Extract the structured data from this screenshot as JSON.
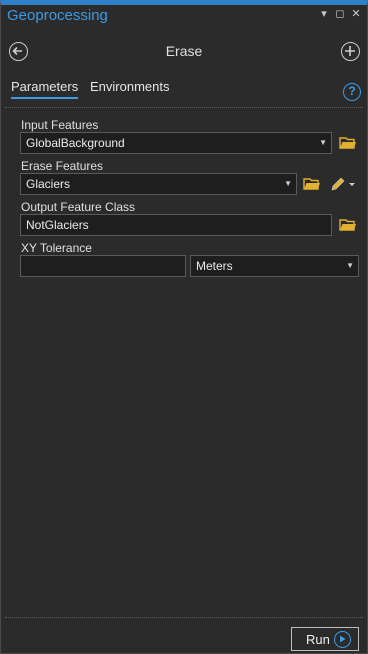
{
  "window": {
    "title": "Geoprocessing",
    "colors": {
      "accent": "#3a9be6",
      "folder": "#e0b030",
      "background": "#2b2b2b"
    }
  },
  "tool": {
    "name": "Erase"
  },
  "tabs": [
    {
      "label": "Parameters"
    },
    {
      "label": "Environments"
    }
  ],
  "params": {
    "input_features": {
      "label": "Input Features",
      "value": "GlobalBackground"
    },
    "erase_features": {
      "label": "Erase Features",
      "value": "Glaciers"
    },
    "output_feature_class": {
      "label": "Output Feature Class",
      "value": "NotGlaciers"
    },
    "xy_tolerance": {
      "label": "XY Tolerance",
      "value": "",
      "unit": "Meters"
    }
  },
  "footer": {
    "run_label": "Run"
  },
  "icons": {
    "help": "?",
    "pin": "▾",
    "maximize": "◻",
    "close": "✕"
  }
}
